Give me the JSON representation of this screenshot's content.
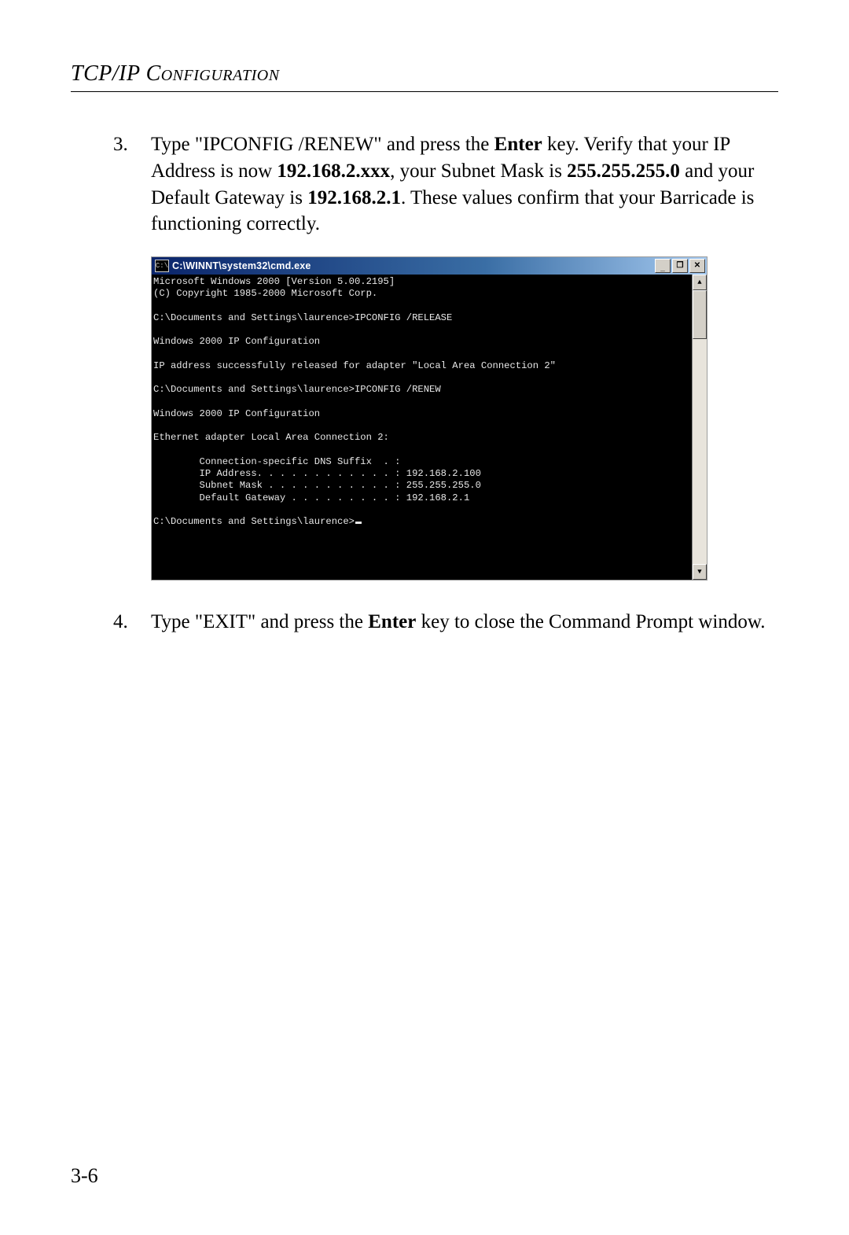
{
  "header": {
    "title_prefix": "TCP/IP ",
    "title_smallcaps": "Configuration"
  },
  "step3": {
    "num": "3.",
    "t1": "Type \"IPCONFIG /RENEW\" and press the ",
    "bold1": "Enter",
    "t2": " key. Verify that your IP Address is now ",
    "bold2": "192.168.2.xxx",
    "t3": ", your Subnet Mask is ",
    "bold3": "255.255.255.0",
    "t4": " and your Default Gateway is ",
    "bold4": "192.168.2.1",
    "t5": ". These values confirm that your Barricade is functioning correctly."
  },
  "cmd": {
    "icon_glyph": "C:\\",
    "title": "C:\\WINNT\\system32\\cmd.exe",
    "min": "_",
    "max": "❐",
    "close": "✕",
    "scroll_up": "▲",
    "scroll_down": "▼",
    "lines": {
      "l01": "Microsoft Windows 2000 [Version 5.00.2195]",
      "l02": "(C) Copyright 1985-2000 Microsoft Corp.",
      "l03": "",
      "l04": "C:\\Documents and Settings\\laurence>IPCONFIG /RELEASE",
      "l05": "",
      "l06": "Windows 2000 IP Configuration",
      "l07": "",
      "l08": "IP address successfully released for adapter \"Local Area Connection 2\"",
      "l09": "",
      "l10": "C:\\Documents and Settings\\laurence>IPCONFIG /RENEW",
      "l11": "",
      "l12": "Windows 2000 IP Configuration",
      "l13": "",
      "l14": "Ethernet adapter Local Area Connection 2:",
      "l15": "",
      "l16": "        Connection-specific DNS Suffix  . :",
      "l17": "        IP Address. . . . . . . . . . . . : 192.168.2.100",
      "l18": "        Subnet Mask . . . . . . . . . . . : 255.255.255.0",
      "l19": "        Default Gateway . . . . . . . . . : 192.168.2.1",
      "l20": "",
      "l21": "C:\\Documents and Settings\\laurence>"
    }
  },
  "step4": {
    "num": "4.",
    "t1": "Type \"EXIT\" and press the ",
    "bold1": "Enter",
    "t2": " key to close the Command Prompt window."
  },
  "page_number": "3-6"
}
